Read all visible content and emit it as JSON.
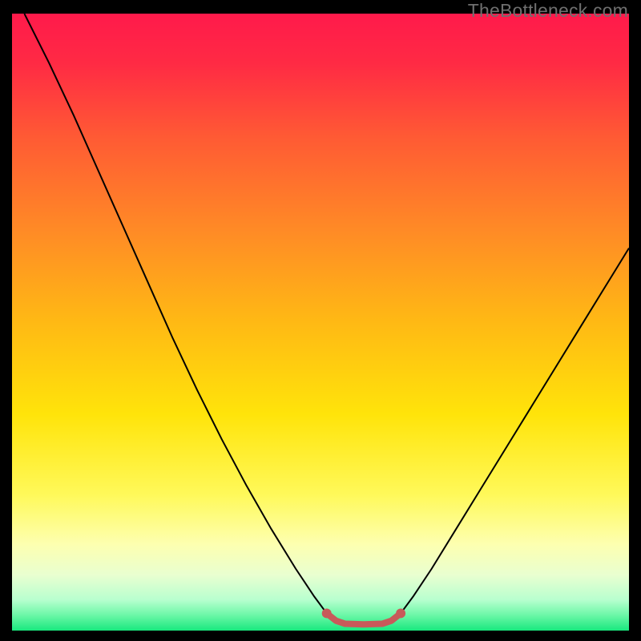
{
  "watermark": "TheBottleneck.com",
  "chart_data": {
    "type": "line",
    "title": "",
    "xlabel": "",
    "ylabel": "",
    "xlim": [
      0,
      100
    ],
    "ylim": [
      0,
      100
    ],
    "background_gradient": {
      "stops": [
        {
          "offset": 0.0,
          "color": "#ff1a4b"
        },
        {
          "offset": 0.08,
          "color": "#ff2a44"
        },
        {
          "offset": 0.2,
          "color": "#ff5a34"
        },
        {
          "offset": 0.35,
          "color": "#ff8a26"
        },
        {
          "offset": 0.5,
          "color": "#ffb914"
        },
        {
          "offset": 0.65,
          "color": "#ffe40a"
        },
        {
          "offset": 0.78,
          "color": "#fff95a"
        },
        {
          "offset": 0.86,
          "color": "#fdffb0"
        },
        {
          "offset": 0.91,
          "color": "#e9ffd0"
        },
        {
          "offset": 0.95,
          "color": "#b8ffcf"
        },
        {
          "offset": 0.975,
          "color": "#6cf7a7"
        },
        {
          "offset": 1.0,
          "color": "#19e87e"
        }
      ]
    },
    "series": [
      {
        "name": "bottleneck-curve",
        "color": "#000000",
        "stroke_width": 2,
        "points": [
          {
            "x": 2.0,
            "y": 100.0
          },
          {
            "x": 6.0,
            "y": 92.0
          },
          {
            "x": 10.0,
            "y": 83.5
          },
          {
            "x": 14.0,
            "y": 74.5
          },
          {
            "x": 18.0,
            "y": 65.5
          },
          {
            "x": 22.0,
            "y": 56.5
          },
          {
            "x": 26.0,
            "y": 47.5
          },
          {
            "x": 30.0,
            "y": 39.0
          },
          {
            "x": 34.0,
            "y": 31.0
          },
          {
            "x": 38.0,
            "y": 23.5
          },
          {
            "x": 42.0,
            "y": 16.5
          },
          {
            "x": 46.0,
            "y": 10.0
          },
          {
            "x": 49.0,
            "y": 5.5
          },
          {
            "x": 51.0,
            "y": 2.8
          },
          {
            "x": 52.5,
            "y": 1.5
          },
          {
            "x": 54.0,
            "y": 1.0
          },
          {
            "x": 57.0,
            "y": 0.9
          },
          {
            "x": 60.0,
            "y": 1.0
          },
          {
            "x": 61.5,
            "y": 1.5
          },
          {
            "x": 63.0,
            "y": 2.8
          },
          {
            "x": 65.0,
            "y": 5.5
          },
          {
            "x": 68.0,
            "y": 10.0
          },
          {
            "x": 72.0,
            "y": 16.5
          },
          {
            "x": 76.0,
            "y": 23.0
          },
          {
            "x": 80.0,
            "y": 29.5
          },
          {
            "x": 84.0,
            "y": 36.0
          },
          {
            "x": 88.0,
            "y": 42.5
          },
          {
            "x": 92.0,
            "y": 49.0
          },
          {
            "x": 96.0,
            "y": 55.5
          },
          {
            "x": 100.0,
            "y": 62.0
          }
        ]
      },
      {
        "name": "optimal-range-marker",
        "color": "#c85a5a",
        "stroke_width": 8,
        "linecap": "round",
        "points": [
          {
            "x": 51.0,
            "y": 2.8
          },
          {
            "x": 52.5,
            "y": 1.6
          },
          {
            "x": 54.0,
            "y": 1.1
          },
          {
            "x": 57.0,
            "y": 1.0
          },
          {
            "x": 60.0,
            "y": 1.1
          },
          {
            "x": 61.5,
            "y": 1.6
          },
          {
            "x": 63.0,
            "y": 2.8
          }
        ],
        "end_markers": [
          {
            "x": 51.0,
            "y": 2.8,
            "r": 6
          },
          {
            "x": 63.0,
            "y": 2.8,
            "r": 6
          }
        ]
      }
    ]
  }
}
